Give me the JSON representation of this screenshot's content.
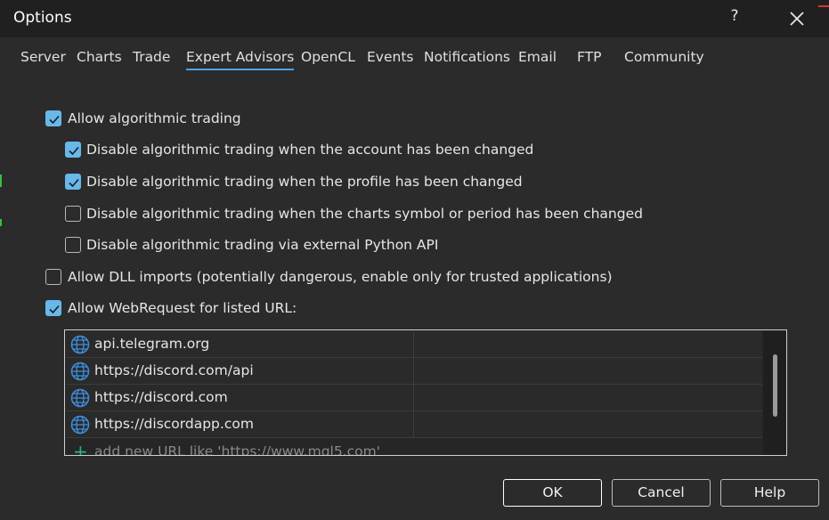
{
  "window": {
    "title": "Options",
    "help_label": "?"
  },
  "tabs": [
    {
      "label": "Server"
    },
    {
      "label": "Charts"
    },
    {
      "label": "Trade"
    },
    {
      "label": "Expert Advisors",
      "active": true
    },
    {
      "label": "OpenCL"
    },
    {
      "label": "Events"
    },
    {
      "label": "Notifications"
    },
    {
      "label": "Email"
    },
    {
      "label": "FTP"
    },
    {
      "label": "Community"
    }
  ],
  "options": {
    "allow_algo": {
      "label": "Allow algorithmic trading",
      "checked": true
    },
    "disable_account": {
      "label": "Disable algorithmic trading when the account has been changed",
      "checked": true
    },
    "disable_profile": {
      "label": "Disable algorithmic trading when the profile has been changed",
      "checked": true
    },
    "disable_symbol": {
      "label": "Disable algorithmic trading when the charts symbol or period has been changed",
      "checked": false
    },
    "disable_python": {
      "label": "Disable algorithmic trading via external Python API",
      "checked": false
    },
    "allow_dll": {
      "label": "Allow DLL imports (potentially dangerous, enable only for trusted applications)",
      "checked": false
    },
    "allow_webrequest": {
      "label": "Allow WebRequest for listed URL:",
      "checked": true
    }
  },
  "url_list": {
    "items": [
      {
        "url": "api.telegram.org"
      },
      {
        "url": "https://discord.com/api"
      },
      {
        "url": "https://discord.com"
      },
      {
        "url": "https://discordapp.com"
      }
    ],
    "add_placeholder": "add new URL like 'https://www.mql5.com'"
  },
  "buttons": {
    "ok": "OK",
    "cancel": "Cancel",
    "help": "Help"
  },
  "colors": {
    "accent": "#4fa3e0",
    "checkbox": "#68b8ea",
    "globe": "#3d8fe0",
    "add": "#2fb37a"
  },
  "icons": {
    "url_item": "globe-icon",
    "add": "plus-icon",
    "close": "close-icon"
  }
}
